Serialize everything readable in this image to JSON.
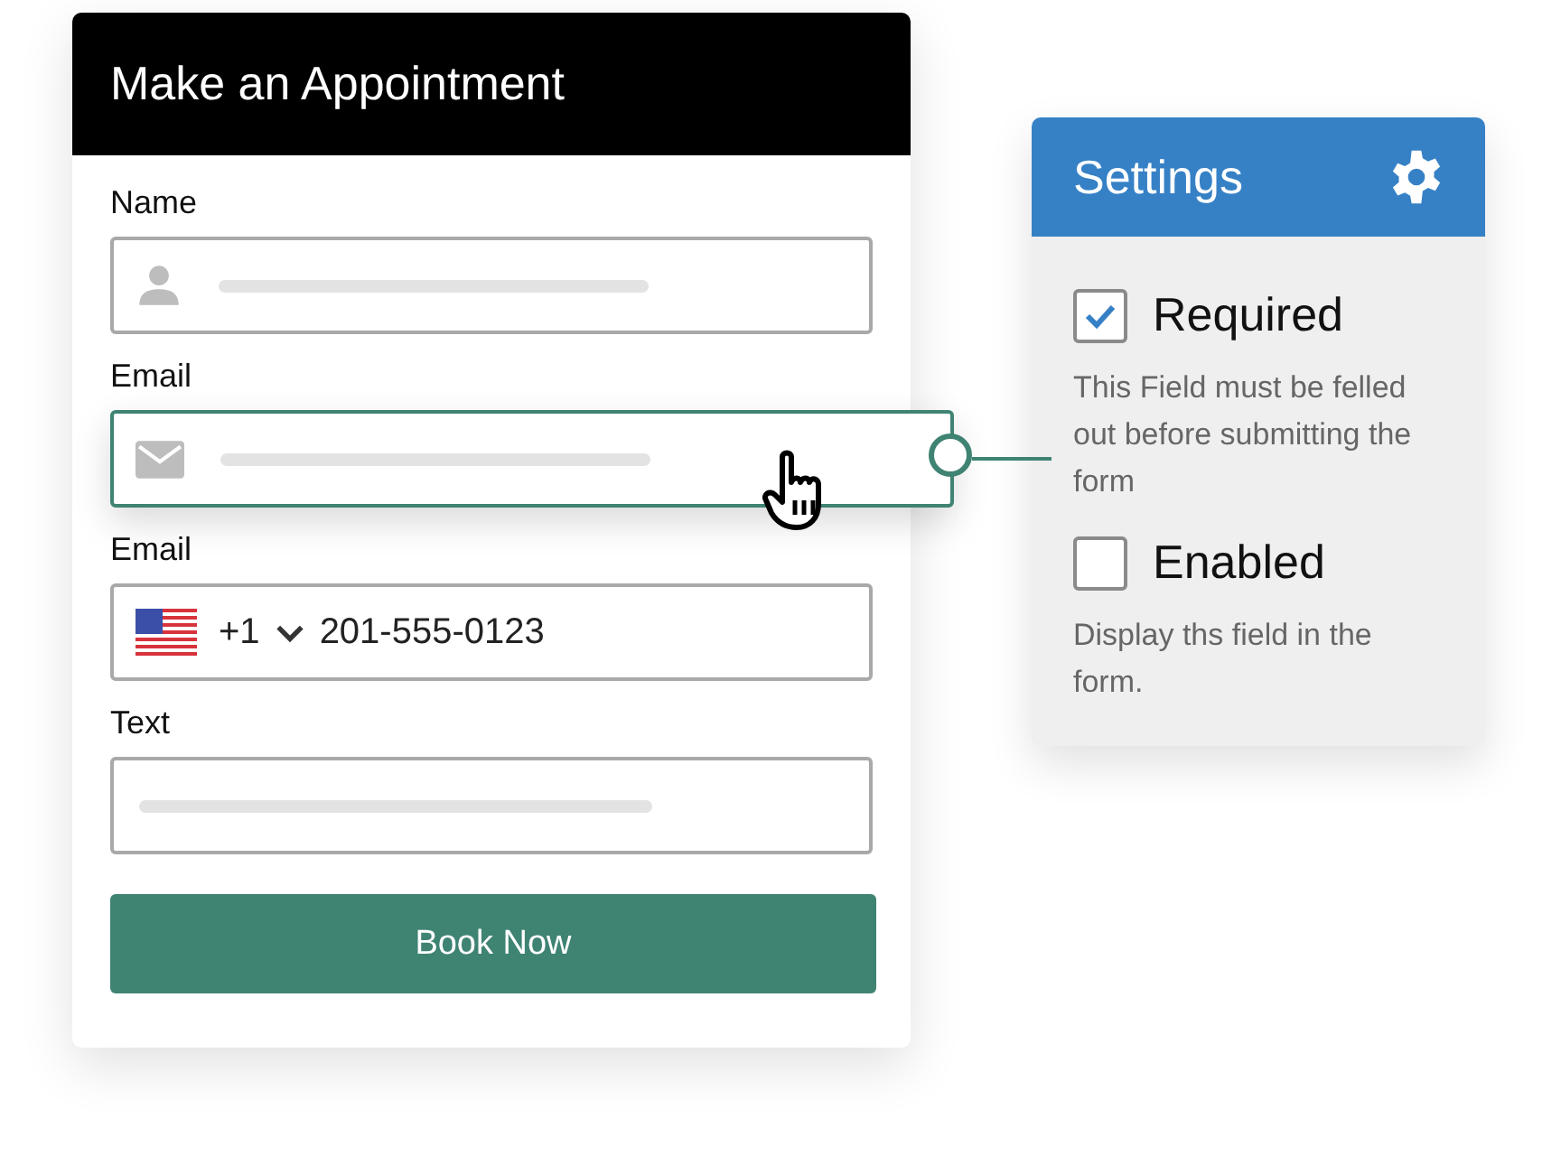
{
  "form": {
    "title": "Make an Appointment",
    "fields": [
      {
        "label": "Name",
        "kind": "text",
        "highlighted": false
      },
      {
        "label": "Email",
        "kind": "email",
        "highlighted": true
      },
      {
        "label": "Email",
        "kind": "phone",
        "highlighted": false,
        "country_code": "+1",
        "value": "201-555-0123"
      },
      {
        "label": "Text",
        "kind": "plain",
        "highlighted": false
      }
    ],
    "submit": "Book Now"
  },
  "settings": {
    "title": "Settings",
    "options": [
      {
        "label": "Required",
        "checked": true,
        "description": "This Field must be felled out before submitting the form"
      },
      {
        "label": "Enabled",
        "checked": false,
        "description": "Display ths field in the form."
      }
    ]
  }
}
